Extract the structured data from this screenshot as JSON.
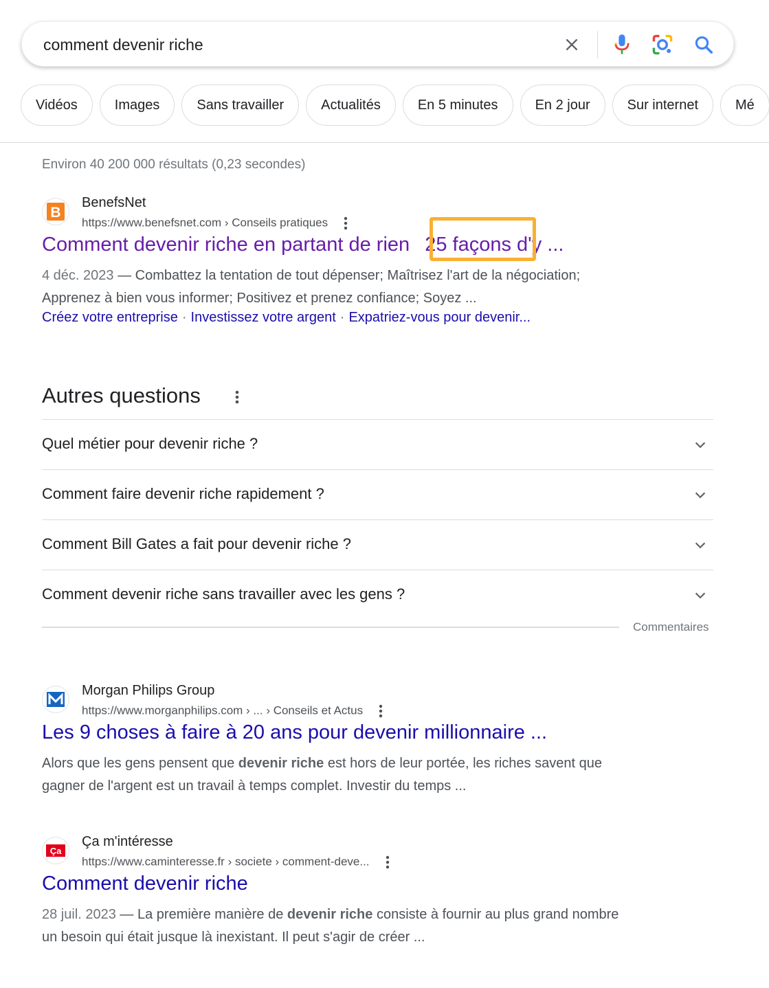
{
  "search": {
    "query": "comment devenir riche"
  },
  "chips": [
    "Vidéos",
    "Images",
    "Sans travailler",
    "Actualités",
    "En 5 minutes",
    "En 2 jour",
    "Sur internet",
    "Mé"
  ],
  "stats": "Environ 40 200 000 résultats (0,23 secondes)",
  "results": [
    {
      "site_name": "BenefsNet",
      "url": "https://www.benefsnet.com › Conseils pratiques",
      "title_pre": "Comment devenir riche en partant de rien ",
      "title_highlight": "25 façons",
      "title_post": " d'y ...",
      "date": "4 déc. 2023",
      "snippet_line1": " — Combattez la tentation de tout dépenser; Maîtrisez l'art de la négociation;",
      "snippet_line2": "Apprenez à bien vous informer; Positivez et prenez confiance; Soyez ...",
      "sitelinks": [
        "Créez votre entreprise",
        "Investissez votre argent",
        "Expatriez-vous pour devenir..."
      ],
      "favicon_letter": "B"
    },
    {
      "site_name": "Morgan Philips Group",
      "url": "https://www.morganphilips.com › ... › Conseils et Actus",
      "title": "Les 9 choses à faire à 20 ans pour devenir millionnaire ...",
      "snippet_a": "Alors que les gens pensent que ",
      "snippet_bold": "devenir riche",
      "snippet_b": " est hors de leur portée, les riches savent que",
      "snippet_line2": "gagner de l'argent est un travail à temps complet. Investir du temps ...",
      "favicon_letter": "M"
    },
    {
      "site_name": "Ça m'intéresse",
      "url": "https://www.caminteresse.fr › societe › comment-deve...",
      "title": "Comment devenir riche",
      "date": "28 juil. 2023",
      "snippet_a": " — La première manière de ",
      "snippet_bold": "devenir riche",
      "snippet_b": " consiste à fournir au plus grand nombre",
      "snippet_line2": "un besoin qui était jusque là inexistant. Il peut s'agir de créer ...",
      "favicon_letter": "Ça"
    }
  ],
  "paa": {
    "title": "Autres questions",
    "questions": [
      "Quel métier pour devenir riche ?",
      "Comment faire devenir riche rapidement ?",
      "Comment Bill Gates a fait pour devenir riche ?",
      "Comment devenir riche sans travailler avec les gens ?"
    ],
    "feedback": "Commentaires"
  },
  "colors": {
    "link": "#1a0dab",
    "visited": "#681da8",
    "highlight": "#f9b031",
    "benefsnet_orange": "#f58220",
    "morgan_blue": "#1565c0",
    "caminteresse_red": "#e3001b"
  }
}
